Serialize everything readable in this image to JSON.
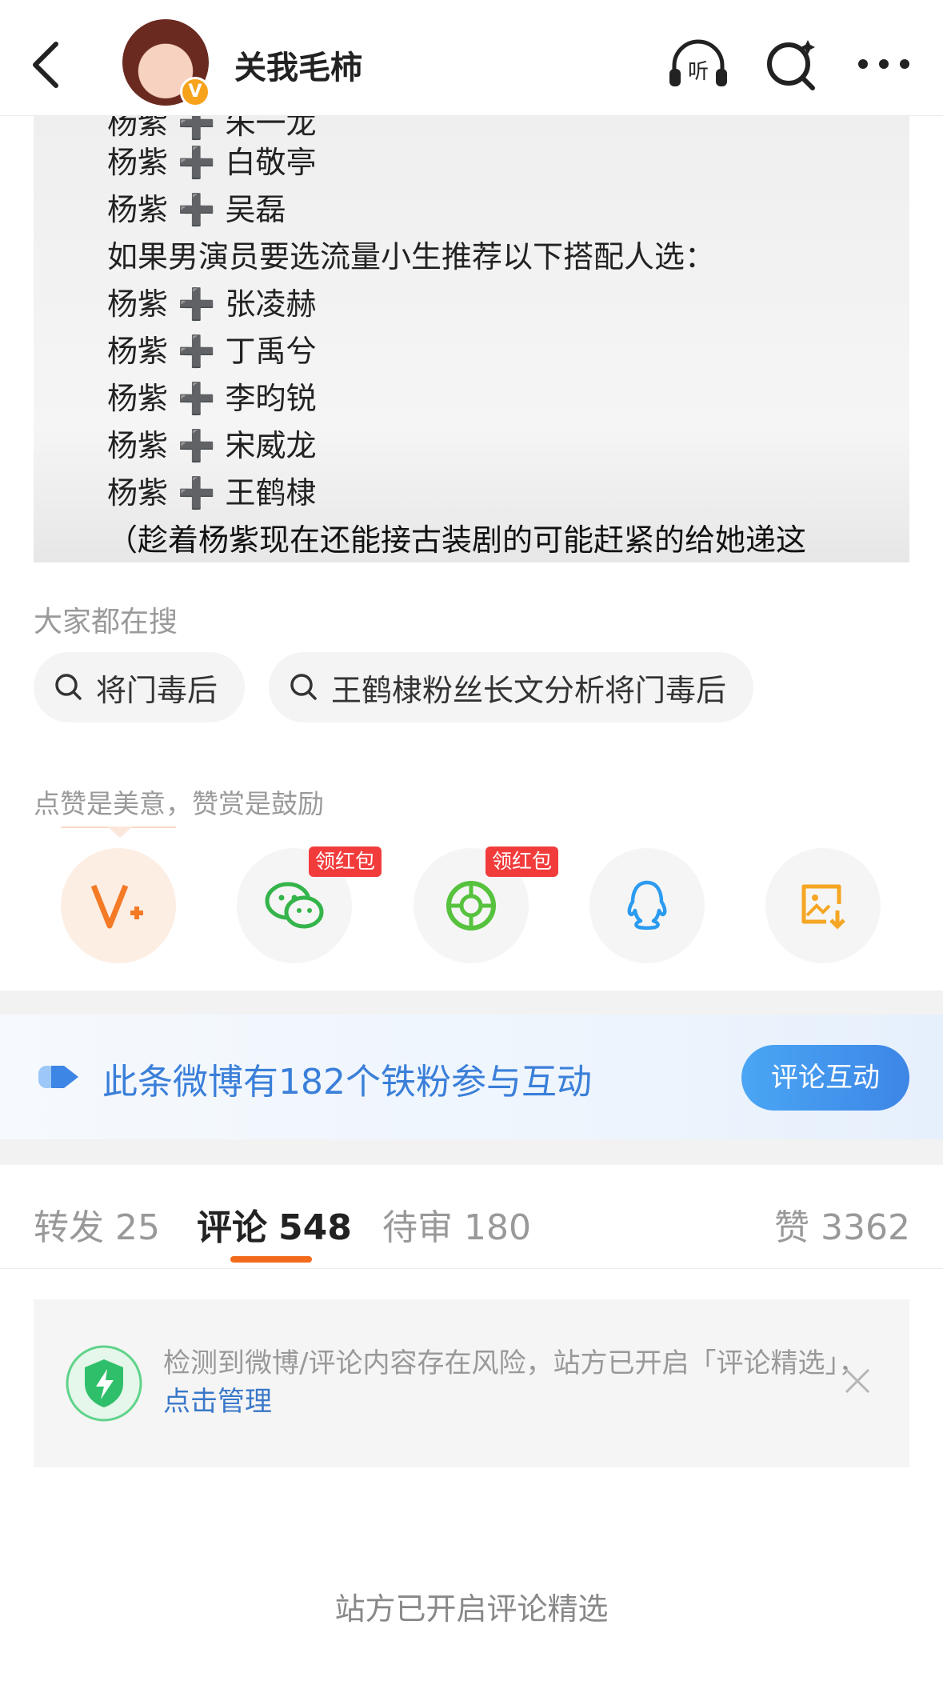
{
  "header": {
    "username": "关我毛柿",
    "verified_badge": "V",
    "icons": [
      "back-icon",
      "listen-icon",
      "search-icon",
      "more-icon"
    ],
    "listen_label": "听"
  },
  "post_image": {
    "lines": [
      "杨紫 ➕ 朱一龙",
      "杨紫 ➕ 白敬亭",
      "杨紫 ➕ 吴磊",
      "如果男演员要选流量小生推荐以下搭配人选：",
      "杨紫 ➕ 张凌赫",
      "杨紫 ➕ 丁禹兮",
      "杨紫 ➕ 李昀锐",
      "杨紫 ➕ 宋威龙",
      "杨紫 ➕ 王鹤棣",
      "（趁着杨紫现在还能接古装剧的可能赶紧的给她递这"
    ]
  },
  "search_section": {
    "title": "大家都在搜",
    "chips": [
      "将门毒后",
      "王鹤棣粉丝长文分析将门毒后"
    ]
  },
  "reward_section": {
    "title": "点赞是美意，赞赏是鼓励",
    "share_targets": [
      {
        "icon": "weibo-v-plus-icon",
        "badge": ""
      },
      {
        "icon": "wechat-icon",
        "badge": "领红包"
      },
      {
        "icon": "moments-icon",
        "badge": "领红包"
      },
      {
        "icon": "qq-icon",
        "badge": ""
      },
      {
        "icon": "save-image-icon",
        "badge": ""
      }
    ]
  },
  "fan_banner": {
    "text": "此条微博有182个铁粉参与互动",
    "button": "评论互动"
  },
  "tabs": [
    {
      "label": "转发",
      "count": "25",
      "active": false
    },
    {
      "label": "评论",
      "count": "548",
      "active": true
    },
    {
      "label": "待审",
      "count": "180",
      "active": false
    },
    {
      "label": "赞",
      "count": "3362",
      "active": false
    }
  ],
  "notice": {
    "text": "检测到微博/评论内容存在风险，站方已开启「评论精选」，",
    "link": "点击管理"
  },
  "footer_text": "站方已开启评论精选",
  "colors": {
    "accent": "#f26b1d",
    "link": "#3a78c9",
    "banner_text": "#3a7fd9",
    "badge_red": "#f23c3c"
  }
}
